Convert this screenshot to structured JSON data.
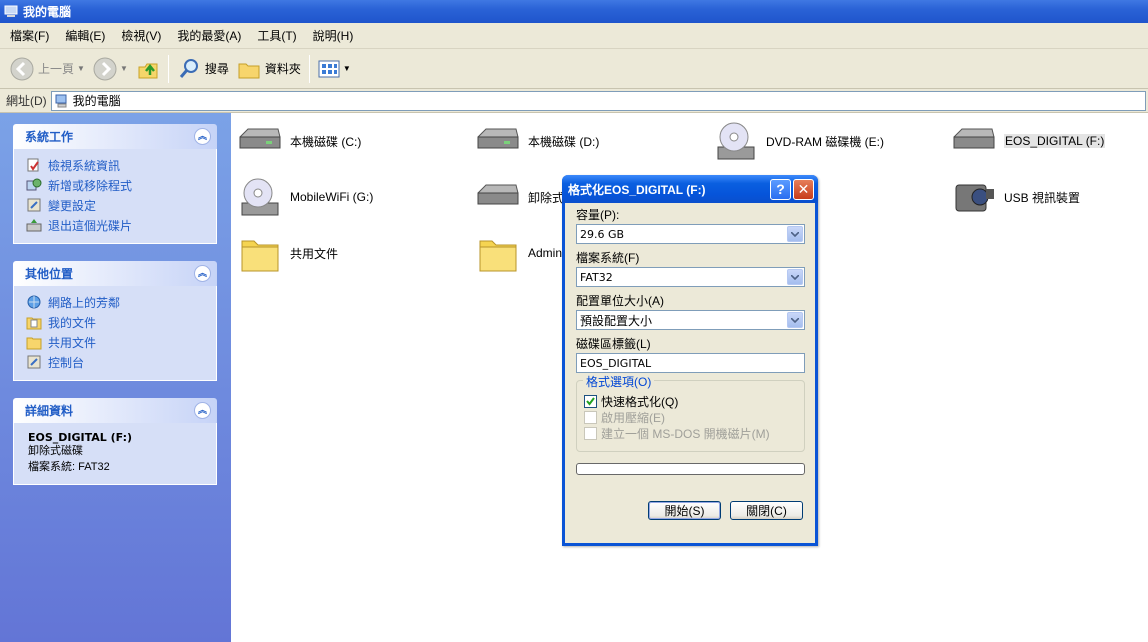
{
  "window": {
    "title": "我的電腦"
  },
  "menu": [
    "檔案(F)",
    "編輯(E)",
    "檢視(V)",
    "我的最愛(A)",
    "工具(T)",
    "說明(H)"
  ],
  "toolbar": {
    "back": "上一頁",
    "search": "搜尋",
    "folders": "資料夾"
  },
  "address": {
    "label": "網址(D)",
    "value": "我的電腦"
  },
  "left_pane": {
    "system_tasks": {
      "title": "系統工作",
      "items": [
        "檢視系統資訊",
        "新增或移除程式",
        "變更設定",
        "退出這個光碟片"
      ]
    },
    "other_places": {
      "title": "其他位置",
      "items": [
        "網路上的芳鄰",
        "我的文件",
        "共用文件",
        "控制台"
      ]
    },
    "details": {
      "title": "詳細資料",
      "name": "EOS_DIGITAL (F:)",
      "type": "卸除式磁碟",
      "filesystem": "檔案系統: FAT32"
    }
  },
  "items": [
    {
      "label": "本機磁碟 (C:)",
      "icon": "hard-drive-icon"
    },
    {
      "label": "本機磁碟 (D:)",
      "icon": "hard-drive-icon"
    },
    {
      "label": "DVD-RAM 磁碟機 (E:)",
      "icon": "dvd-drive-icon"
    },
    {
      "label": "EOS_DIGITAL (F:)",
      "icon": "removable-drive-icon"
    },
    {
      "label": "MobileWiFi (G:)",
      "icon": "cd-drive-icon"
    },
    {
      "label": "卸除式",
      "icon": "removable-drive-icon"
    },
    {
      "label": "USB 視訊裝置",
      "icon": "camera-icon"
    },
    {
      "label": "共用文件",
      "icon": "folder-icon"
    },
    {
      "label": "Admini",
      "icon": "folder-icon"
    }
  ],
  "dialog": {
    "title": "格式化EOS_DIGITAL (F:)",
    "capacity_label": "容量(P):",
    "capacity_value": "29.6 GB",
    "filesystem_label": "檔案系統(F)",
    "filesystem_value": "FAT32",
    "allocation_label": "配置單位大小(A)",
    "allocation_value": "預設配置大小",
    "volume_label_label": "磁碟區標籤(L)",
    "volume_label_value": "EOS_DIGITAL",
    "options_title": "格式選項(O)",
    "opt_quick": "快速格式化(Q)",
    "opt_compress": "啟用壓縮(E)",
    "opt_msdos": "建立一個 MS-DOS 開機磁片(M)",
    "progress": 0,
    "start_button": "開始(S)",
    "close_button": "關閉(C)"
  }
}
